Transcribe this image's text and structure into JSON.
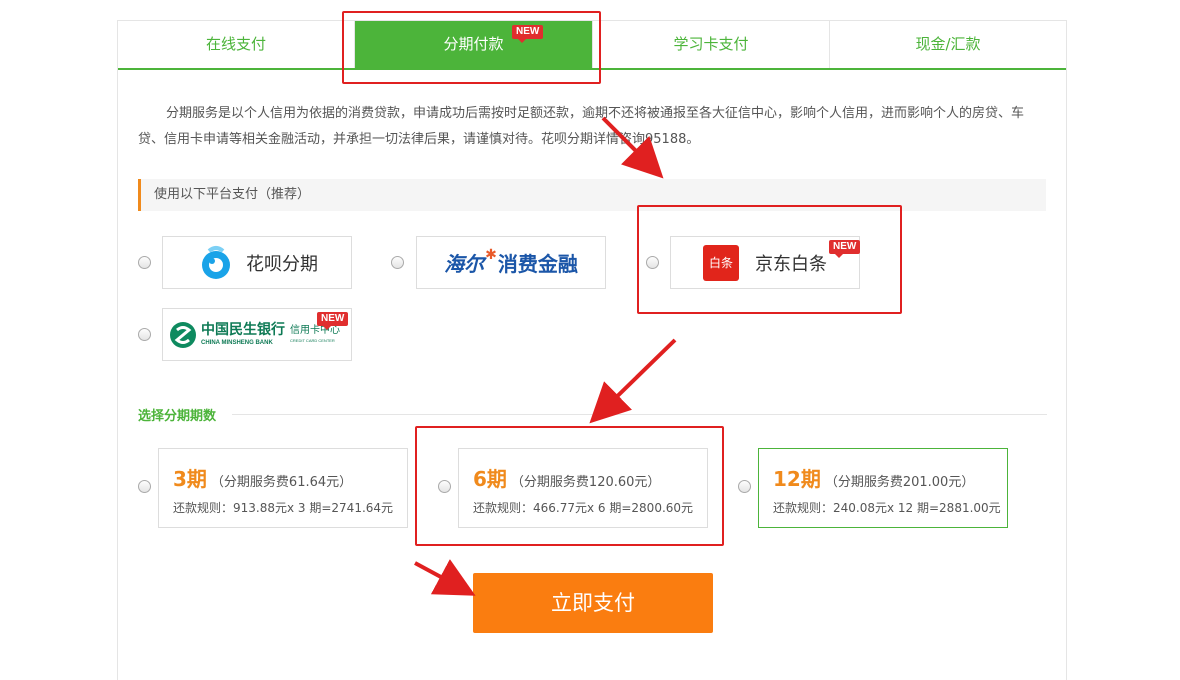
{
  "tabs": [
    {
      "label": "在线支付",
      "active": false
    },
    {
      "label": "分期付款",
      "active": true,
      "badge": "NEW"
    },
    {
      "label": "学习卡支付",
      "active": false
    },
    {
      "label": "现金/汇款",
      "active": false
    }
  ],
  "description": "分期服务是以个人信用为依据的消费贷款，申请成功后需按时足额还款，逾期不还将被通报至各大征信中心，影响个人信用，进而影响个人的房贷、车贷、信用卡申请等相关金融活动，并承担一切法律后果，请谨慎对待。花呗分期详情咨询95188。",
  "platform_section": {
    "title": "使用以下平台支付（推荐）"
  },
  "platforms": [
    {
      "name": "花呗分期",
      "icon": "huabei-logo"
    },
    {
      "name": "海尔消费金融",
      "logo_text_a": "海尔",
      "logo_text_b": "消费金融",
      "icon": "haier-logo"
    },
    {
      "name": "京东白条",
      "icon_text": "白条",
      "badge": "NEW",
      "icon": "jd-baitiao-logo"
    },
    {
      "name": "中国民生银行",
      "name_en": "CHINA MINSHENG BANK",
      "sub": "信用卡中心",
      "sub_en": "CREDIT CARD CENTER",
      "badge": "NEW",
      "icon": "minsheng-logo"
    }
  ],
  "term_section": {
    "title": "选择分期期数"
  },
  "terms": [
    {
      "period": "3期",
      "fee": "（分期服务费61.64元）",
      "rule": "还款规则：913.88元x 3 期=2741.64元"
    },
    {
      "period": "6期",
      "fee": "（分期服务费120.60元）",
      "rule": "还款规则：466.77元x 6 期=2800.60元"
    },
    {
      "period": "12期",
      "fee": "（分期服务费201.00元）",
      "rule": "还款规则：240.08元x 12 期=2881.00元",
      "selected": true
    }
  ],
  "pay_button": "立即支付",
  "colors": {
    "green": "#4cb43a",
    "orange": "#fa7d10",
    "annotation_red": "#e02020"
  }
}
